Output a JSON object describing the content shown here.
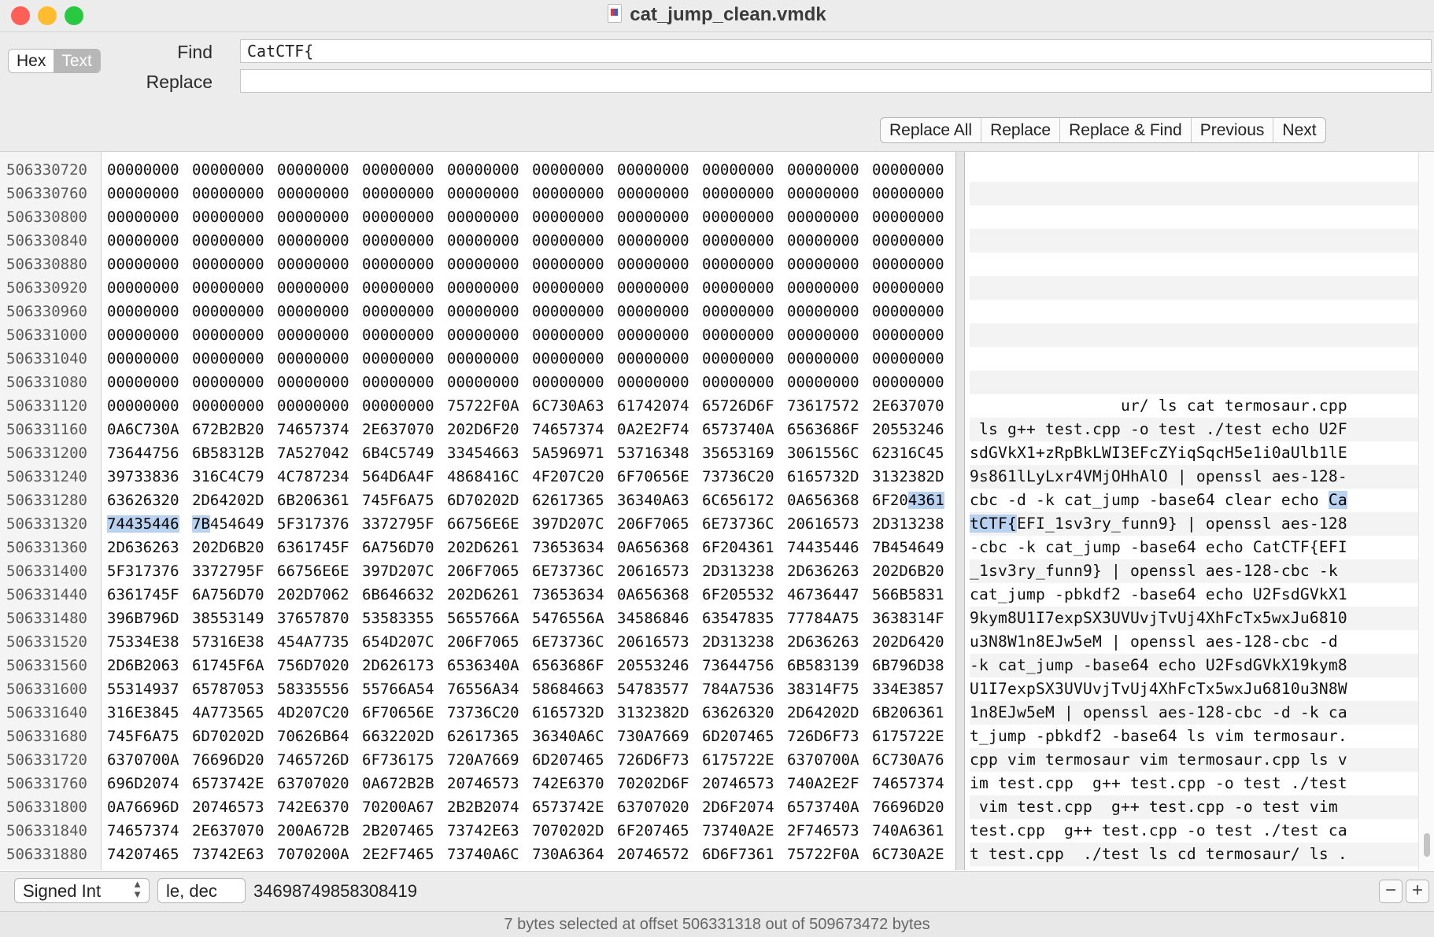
{
  "window": {
    "title": "cat_jump_clean.vmdk",
    "traffic_light_colors": [
      "#ff5f57",
      "#febc2e",
      "#28c840"
    ]
  },
  "toolbar": {
    "mode_hex": "Hex",
    "mode_text": "Text",
    "active_mode": "Text",
    "find_label": "Find",
    "find_value": "CatCTF{",
    "replace_label": "Replace",
    "replace_value": "",
    "buttons": {
      "replace_all": "Replace All",
      "replace": "Replace",
      "replace_and_find": "Replace & Find",
      "previous": "Previous",
      "next": "Next"
    }
  },
  "hex_view": {
    "selection_color": "#b8d2ef",
    "rows": [
      {
        "offset": "506330720",
        "hex": [
          "00000000",
          "00000000",
          "00000000",
          "00000000",
          "00000000",
          "00000000",
          "00000000",
          "00000000",
          "00000000",
          "00000000"
        ],
        "text": ""
      },
      {
        "offset": "506330760",
        "hex": [
          "00000000",
          "00000000",
          "00000000",
          "00000000",
          "00000000",
          "00000000",
          "00000000",
          "00000000",
          "00000000",
          "00000000"
        ],
        "text": ""
      },
      {
        "offset": "506330800",
        "hex": [
          "00000000",
          "00000000",
          "00000000",
          "00000000",
          "00000000",
          "00000000",
          "00000000",
          "00000000",
          "00000000",
          "00000000"
        ],
        "text": ""
      },
      {
        "offset": "506330840",
        "hex": [
          "00000000",
          "00000000",
          "00000000",
          "00000000",
          "00000000",
          "00000000",
          "00000000",
          "00000000",
          "00000000",
          "00000000"
        ],
        "text": ""
      },
      {
        "offset": "506330880",
        "hex": [
          "00000000",
          "00000000",
          "00000000",
          "00000000",
          "00000000",
          "00000000",
          "00000000",
          "00000000",
          "00000000",
          "00000000"
        ],
        "text": ""
      },
      {
        "offset": "506330920",
        "hex": [
          "00000000",
          "00000000",
          "00000000",
          "00000000",
          "00000000",
          "00000000",
          "00000000",
          "00000000",
          "00000000",
          "00000000"
        ],
        "text": ""
      },
      {
        "offset": "506330960",
        "hex": [
          "00000000",
          "00000000",
          "00000000",
          "00000000",
          "00000000",
          "00000000",
          "00000000",
          "00000000",
          "00000000",
          "00000000"
        ],
        "text": ""
      },
      {
        "offset": "506331000",
        "hex": [
          "00000000",
          "00000000",
          "00000000",
          "00000000",
          "00000000",
          "00000000",
          "00000000",
          "00000000",
          "00000000",
          "00000000"
        ],
        "text": ""
      },
      {
        "offset": "506331040",
        "hex": [
          "00000000",
          "00000000",
          "00000000",
          "00000000",
          "00000000",
          "00000000",
          "00000000",
          "00000000",
          "00000000",
          "00000000"
        ],
        "text": ""
      },
      {
        "offset": "506331080",
        "hex": [
          "00000000",
          "00000000",
          "00000000",
          "00000000",
          "00000000",
          "00000000",
          "00000000",
          "00000000",
          "00000000",
          "00000000"
        ],
        "text": ""
      },
      {
        "offset": "506331120",
        "hex": [
          "00000000",
          "00000000",
          "00000000",
          "00000000",
          "75722F0A",
          "6C730A63",
          "61742074",
          "65726D6F",
          "73617572",
          "2E637070"
        ],
        "text": "                ur/ ls cat termosaur.cpp"
      },
      {
        "offset": "506331160",
        "hex": [
          "0A6C730A",
          "672B2B20",
          "74657374",
          "2E637070",
          "202D6F20",
          "74657374",
          "0A2E2F74",
          "6573740A",
          "6563686F",
          "20553246"
        ],
        "text": " ls g++ test.cpp -o test ./test echo U2F"
      },
      {
        "offset": "506331200",
        "hex": [
          "73644756",
          "6B58312B",
          "7A527042",
          "6B4C5749",
          "33454663",
          "5A596971",
          "53716348",
          "35653169",
          "3061556C",
          "62316C45"
        ],
        "text": "sdGVkX1+zRpBkLWI3EFcZYiqSqcH5e1i0aUlb1lE"
      },
      {
        "offset": "506331240",
        "hex": [
          "39733836",
          "316C4C79",
          "4C787234",
          "564D6A4F",
          "4868416C",
          "4F207C20",
          "6F70656E",
          "73736C20",
          "6165732D",
          "3132382D"
        ],
        "text": "9s861lLyLxr4VMjOHhAlO | openssl aes-128-"
      },
      {
        "offset": "506331280",
        "hex": [
          "63626320",
          "2D64202D",
          "6B206361",
          "745F6A75",
          "6D70202D",
          "62617365",
          "36340A63",
          "6C656172",
          "0A656368",
          "6F204361"
        ],
        "text": "cbc -d -k cat_jump -base64 clear echo Ca"
      },
      {
        "offset": "506331320",
        "hex": [
          "74435446",
          "7B454649",
          "5F317376",
          "3372795F",
          "66756E6E",
          "397D207C",
          "206F7065",
          "6E73736C",
          "20616573",
          "2D313238"
        ],
        "text": "tCTF{EFI_1sv3ry_funn9} | openssl aes-128"
      },
      {
        "offset": "506331360",
        "hex": [
          "2D636263",
          "202D6B20",
          "6361745F",
          "6A756D70",
          "202D6261",
          "73653634",
          "0A656368",
          "6F204361",
          "74435446",
          "7B454649"
        ],
        "text": "-cbc -k cat_jump -base64 echo CatCTF{EFI"
      },
      {
        "offset": "506331400",
        "hex": [
          "5F317376",
          "3372795F",
          "66756E6E",
          "397D207C",
          "206F7065",
          "6E73736C",
          "20616573",
          "2D313238",
          "2D636263",
          "202D6B20"
        ],
        "text": "_1sv3ry_funn9} | openssl aes-128-cbc -k "
      },
      {
        "offset": "506331440",
        "hex": [
          "6361745F",
          "6A756D70",
          "202D7062",
          "6B646632",
          "202D6261",
          "73653634",
          "0A656368",
          "6F205532",
          "46736447",
          "566B5831"
        ],
        "text": "cat_jump -pbkdf2 -base64 echo U2FsdGVkX1"
      },
      {
        "offset": "506331480",
        "hex": [
          "396B796D",
          "38553149",
          "37657870",
          "53583355",
          "5655766A",
          "5476556A",
          "34586846",
          "63547835",
          "77784A75",
          "3638314F"
        ],
        "text": "9kym8U1I7expSX3UVUvjTvUj4XhFcTx5wxJu6810"
      },
      {
        "offset": "506331520",
        "hex": [
          "75334E38",
          "57316E38",
          "454A7735",
          "654D207C",
          "206F7065",
          "6E73736C",
          "20616573",
          "2D313238",
          "2D636263",
          "202D6420"
        ],
        "text": "u3N8W1n8EJw5eM | openssl aes-128-cbc -d "
      },
      {
        "offset": "506331560",
        "hex": [
          "2D6B2063",
          "61745F6A",
          "756D7020",
          "2D626173",
          "6536340A",
          "6563686F",
          "20553246",
          "73644756",
          "6B583139",
          "6B796D38"
        ],
        "text": "-k cat_jump -base64 echo U2FsdGVkX19kym8"
      },
      {
        "offset": "506331600",
        "hex": [
          "55314937",
          "65787053",
          "58335556",
          "55766A54",
          "76556A34",
          "58684663",
          "54783577",
          "784A7536",
          "38314F75",
          "334E3857"
        ],
        "text": "U1I7expSX3UVUvjTvUj4XhFcTx5wxJu6810u3N8W"
      },
      {
        "offset": "506331640",
        "hex": [
          "316E3845",
          "4A773565",
          "4D207C20",
          "6F70656E",
          "73736C20",
          "6165732D",
          "3132382D",
          "63626320",
          "2D64202D",
          "6B206361"
        ],
        "text": "1n8EJw5eM | openssl aes-128-cbc -d -k ca"
      },
      {
        "offset": "506331680",
        "hex": [
          "745F6A75",
          "6D70202D",
          "70626B64",
          "6632202D",
          "62617365",
          "36340A6C",
          "730A7669",
          "6D207465",
          "726D6F73",
          "6175722E"
        ],
        "text": "t_jump -pbkdf2 -base64 ls vim termosaur."
      },
      {
        "offset": "506331720",
        "hex": [
          "6370700A",
          "76696D20",
          "7465726D",
          "6F736175",
          "720A7669",
          "6D207465",
          "726D6F73",
          "6175722E",
          "6370700A",
          "6C730A76"
        ],
        "text": "cpp vim termosaur vim termosaur.cpp ls v"
      },
      {
        "offset": "506331760",
        "hex": [
          "696D2074",
          "6573742E",
          "63707020",
          "0A672B2B",
          "20746573",
          "742E6370",
          "70202D6F",
          "20746573",
          "740A2E2F",
          "74657374"
        ],
        "text": "im test.cpp  g++ test.cpp -o test ./test"
      },
      {
        "offset": "506331800",
        "hex": [
          "0A76696D",
          "20746573",
          "742E6370",
          "70200A67",
          "2B2B2074",
          "6573742E",
          "63707020",
          "2D6F2074",
          "6573740A",
          "76696D20"
        ],
        "text": " vim test.cpp  g++ test.cpp -o test vim "
      },
      {
        "offset": "506331840",
        "hex": [
          "74657374",
          "2E637070",
          "200A672B",
          "2B207465",
          "73742E63",
          "7070202D",
          "6F207465",
          "73740A2E",
          "2F746573",
          "740A6361"
        ],
        "text": "test.cpp  g++ test.cpp -o test ./test ca"
      },
      {
        "offset": "506331880",
        "hex": [
          "74207465",
          "73742E63",
          "7070200A",
          "2E2F7465",
          "73740A6C",
          "730A6364",
          "20746572",
          "6D6F7361",
          "75722F0A",
          "6C730A2E"
        ],
        "text": "t test.cpp  ./test ls cd termosaur/ ls ."
      }
    ]
  },
  "value_bar": {
    "type_select": "Signed Int",
    "endian_select": "le, dec",
    "value": "34698749858308419"
  },
  "status": {
    "text": "7 bytes selected at offset 506331318 out of 509673472 bytes"
  }
}
